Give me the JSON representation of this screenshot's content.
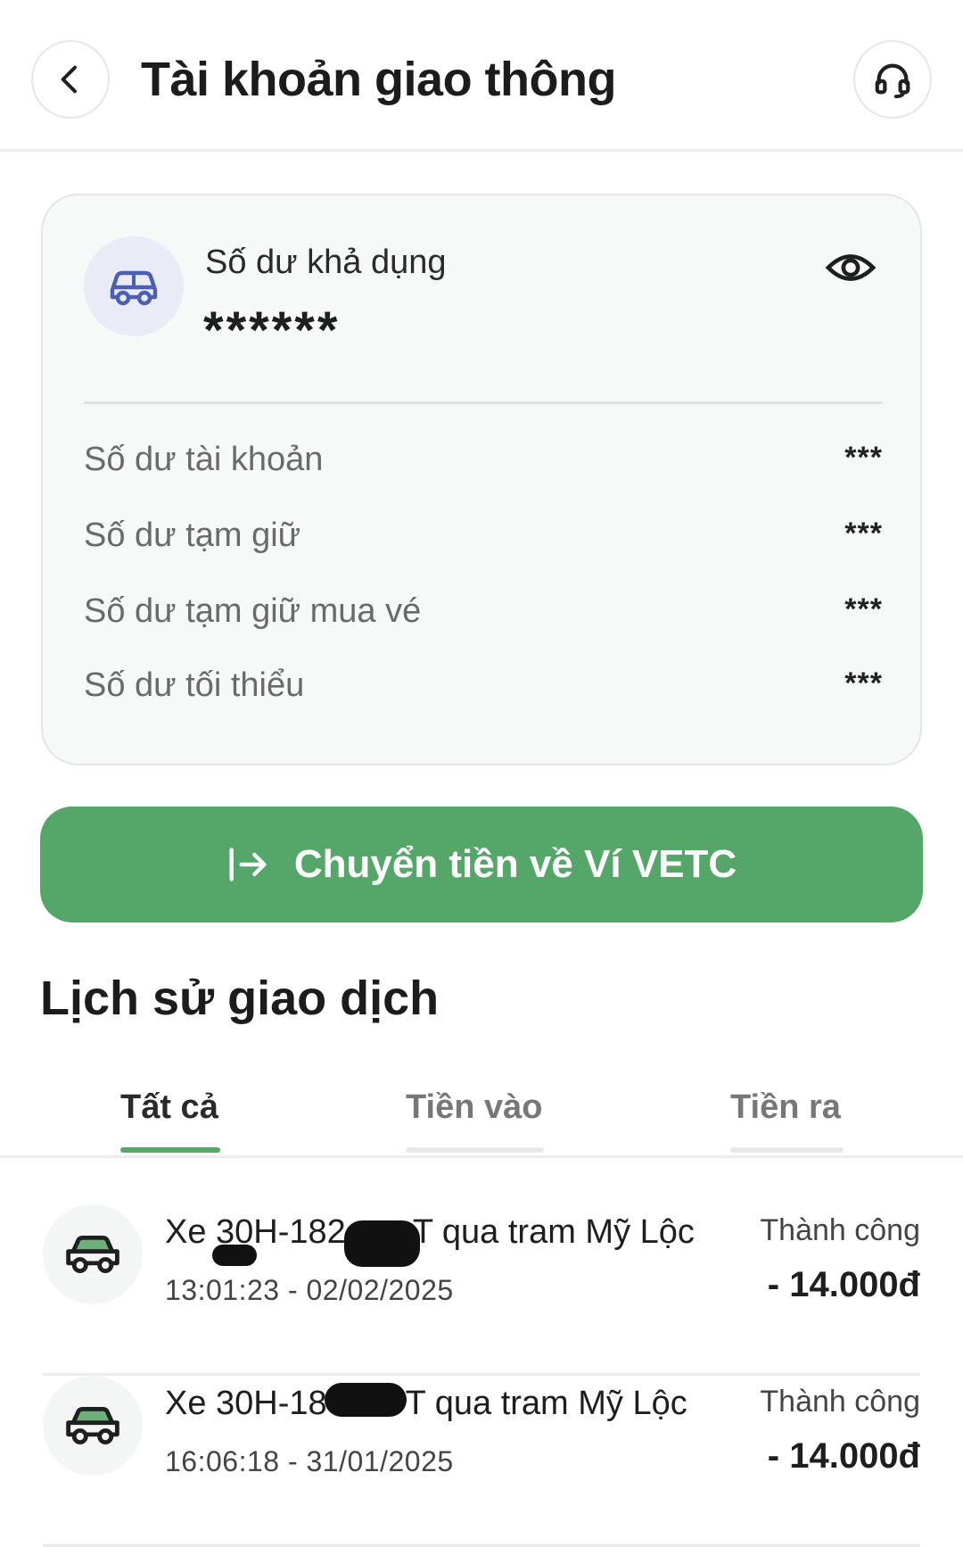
{
  "header": {
    "title": "Tài khoản giao thông",
    "back_icon": "chevron-left-icon",
    "support_icon": "headset-icon"
  },
  "balance_card": {
    "available_label": "Số dư khả dụng",
    "available_value": "******",
    "rows": [
      {
        "label": "Số dư tài khoản",
        "value": "***"
      },
      {
        "label": "Số dư tạm giữ",
        "value": "***"
      },
      {
        "label": "Số dư tạm giữ mua vé",
        "value": "***"
      },
      {
        "label": "Số dư tối thiểu",
        "value": "***"
      }
    ]
  },
  "transfer_button": {
    "label": "Chuyển tiền về Ví VETC",
    "color": "#55a769"
  },
  "history": {
    "title": "Lịch sử giao dịch",
    "tabs": [
      {
        "label": "Tất cả",
        "active": true
      },
      {
        "label": "Tiền vào",
        "active": false
      },
      {
        "label": "Tiền ra",
        "active": false
      }
    ],
    "transactions": [
      {
        "title_prefix": "Xe 30H-182",
        "title_suffix": "T qua tram Mỹ Lộc",
        "time": "13:01:23 - 02/02/2025",
        "status": "Thành công",
        "amount": "- 14.000đ"
      },
      {
        "title_prefix": "Xe 30H-18",
        "title_suffix": "T qua tram Mỹ Lộc",
        "time": "16:06:18 - 31/01/2025",
        "status": "Thành công",
        "amount": "- 14.000đ"
      }
    ]
  }
}
